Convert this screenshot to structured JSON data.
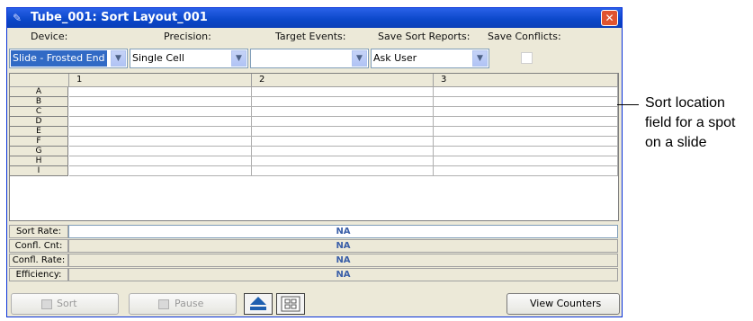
{
  "window": {
    "title": "Tube_001: Sort Layout_001",
    "close_symbol": "✕"
  },
  "headers": {
    "device": "Device:",
    "precision": "Precision:",
    "target_events": "Target Events:",
    "save_sort_reports": "Save Sort Reports:",
    "save_conflicts": "Save Conflicts:"
  },
  "controls": {
    "device": "Slide - Frosted End",
    "precision": "Single Cell",
    "target_events": "",
    "save_sort_reports": "Ask User",
    "save_conflicts_checked": false
  },
  "grid": {
    "columns": [
      "1",
      "2",
      "3"
    ],
    "rows": [
      "A",
      "B",
      "C",
      "D",
      "E",
      "F",
      "G",
      "H",
      "I"
    ]
  },
  "stats": {
    "sort_rate_label": "Sort Rate:",
    "sort_rate_value": "NA",
    "confl_cnt_label": "Confl. Cnt:",
    "confl_cnt_value": "NA",
    "confl_rate_label": "Confl. Rate:",
    "confl_rate_value": "NA",
    "efficiency_label": "Efficiency:",
    "efficiency_value": "NA"
  },
  "buttons": {
    "sort": "Sort",
    "pause": "Pause",
    "view_counters": "View Counters"
  },
  "annotation": {
    "line1": "Sort location",
    "line2": "field for a spot",
    "line3": "on a slide"
  },
  "colors": {
    "titlebar": "#0a46c8",
    "stat_value": "#3a5fa8",
    "selected_highlight": "#316ac5",
    "close_button": "#e0542f"
  },
  "icons": [
    "window-icon",
    "close-icon",
    "chevron-down-icon",
    "eject-icon",
    "plate-icon"
  ]
}
